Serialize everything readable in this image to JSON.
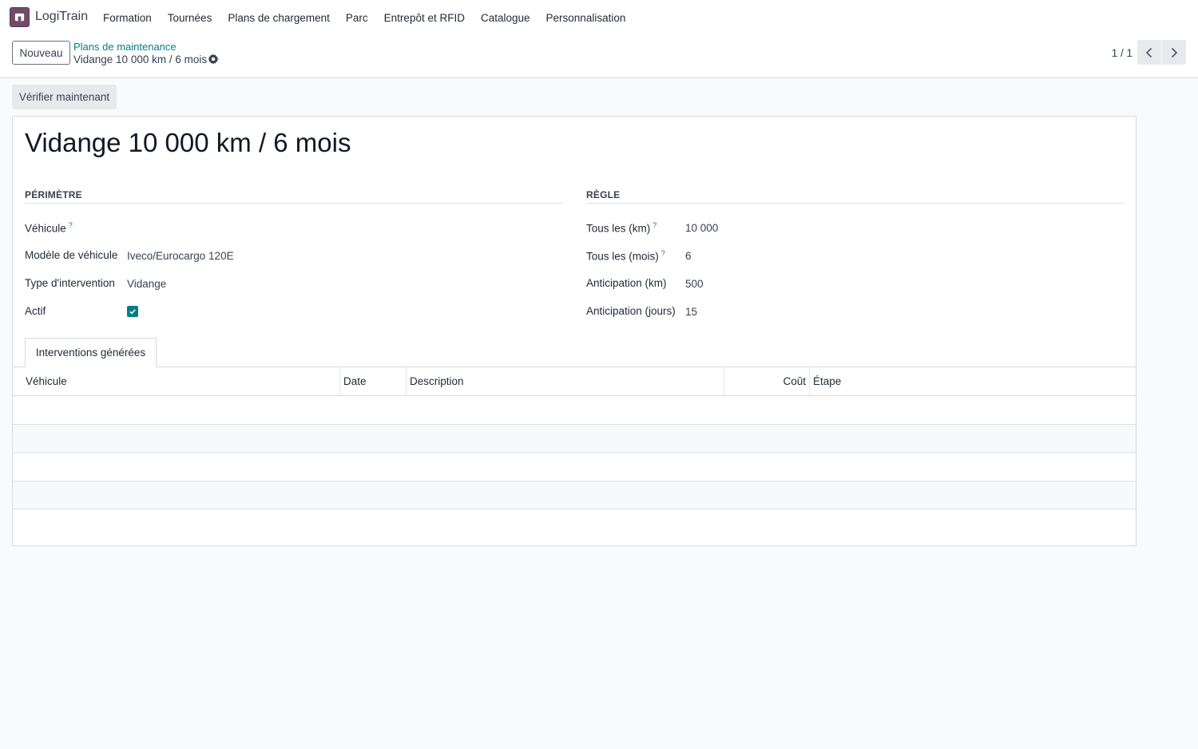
{
  "navbar": {
    "app_name": "LogiTrain",
    "menu": [
      "Formation",
      "Tournées",
      "Plans de chargement",
      "Parc",
      "Entrepôt et RFID",
      "Catalogue",
      "Personnalisation"
    ]
  },
  "control_panel": {
    "new_label": "Nouveau",
    "breadcrumb_parent": "Plans de maintenance",
    "breadcrumb_current": "Vidange 10 000 km / 6 mois",
    "pager": "1 / 1"
  },
  "actions": {
    "check_now": "Vérifier maintenant"
  },
  "form": {
    "title": "Vidange 10 000 km / 6 mois",
    "perimetre": {
      "title": "PÉRIMÈTRE",
      "fields": [
        {
          "label": "Véhicule",
          "help": "?",
          "value": ""
        },
        {
          "label": "Modèle de véhicule",
          "value": "Iveco/Eurocargo 120E"
        },
        {
          "label": "Type d'intervention",
          "value": "Vidange"
        },
        {
          "label": "Actif",
          "checked": true
        }
      ]
    },
    "regle": {
      "title": "RÈGLE",
      "fields": [
        {
          "label": "Tous les (km)",
          "help": "?",
          "value": "10 000"
        },
        {
          "label": "Tous les (mois)",
          "help": "?",
          "value": "6"
        },
        {
          "label": "Anticipation (km)",
          "value": "500"
        },
        {
          "label": "Anticipation (jours)",
          "value": "15"
        }
      ]
    },
    "tabs": [
      "Interventions générées"
    ],
    "table": {
      "columns": [
        "Véhicule",
        "Date",
        "Description",
        "Coût",
        "Étape"
      ],
      "rows": []
    }
  },
  "colors": {
    "brand": "#714b67",
    "accent": "#017e84"
  },
  "icons": [
    "app-logo-icon",
    "gear-icon",
    "chevron-left-icon",
    "chevron-right-icon",
    "check-icon"
  ]
}
